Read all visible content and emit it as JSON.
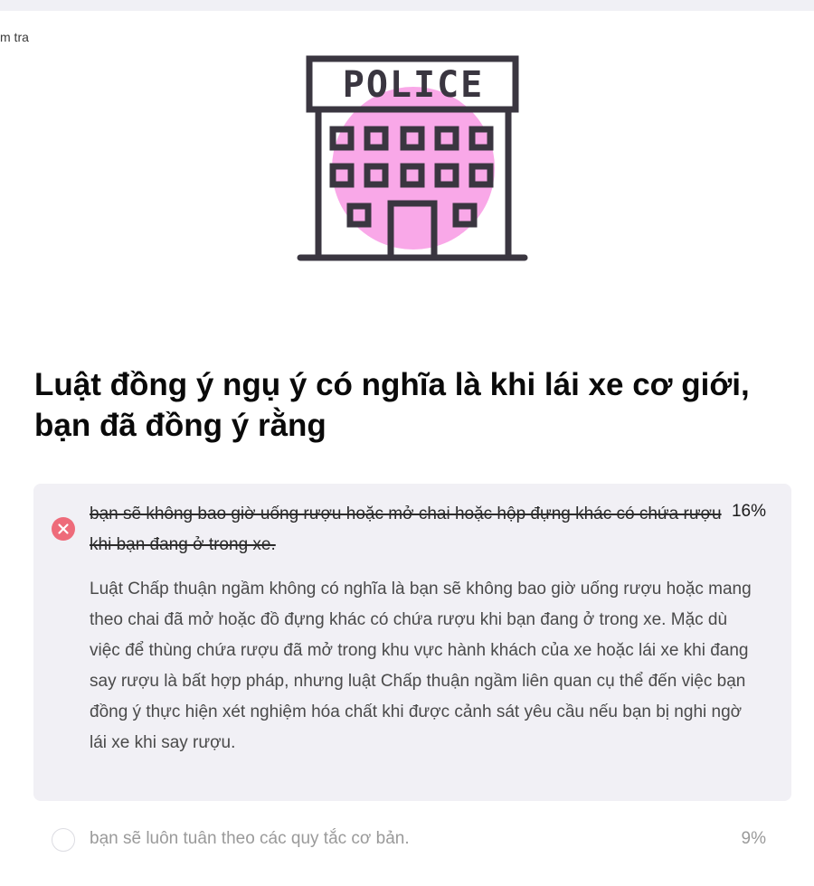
{
  "header": {
    "breadcrumb": "m tra"
  },
  "illustration": {
    "icon": "police-station-icon",
    "sign_text": "POLICE",
    "accent_color": "#f9a8e8",
    "stroke_color": "#3a3640"
  },
  "question": {
    "text": "Luật đồng ý ngụ ý có nghĩa là khi lái xe cơ giới, bạn đã đồng ý rằng"
  },
  "selected_answer": {
    "status": "wrong",
    "status_color": "#ee6b7a",
    "text": "bạn sẽ không bao giờ uống rượu hoặc mở chai hoặc hộp đựng khác có chứa rượu khi bạn đang ở trong xe.",
    "percent": "16%",
    "explanation": "Luật Chấp thuận ngầm không có nghĩa là bạn sẽ không bao giờ uống rượu hoặc mang theo chai đã mở hoặc đồ đựng khác có chứa rượu khi bạn đang ở trong xe. Mặc dù việc để thùng chứa rượu đã mở trong khu vực hành khách của xe hoặc lái xe khi đang say rượu là bất hợp pháp, nhưng luật Chấp thuận ngầm liên quan cụ thể đến việc bạn đồng ý thực hiện xét nghiệm hóa chất khi được cảnh sát yêu cầu nếu bạn bị nghi ngờ lái xe khi say rượu."
  },
  "options": [
    {
      "text": "bạn sẽ luôn tuân theo các quy tắc cơ bản.",
      "percent": "9%"
    }
  ]
}
